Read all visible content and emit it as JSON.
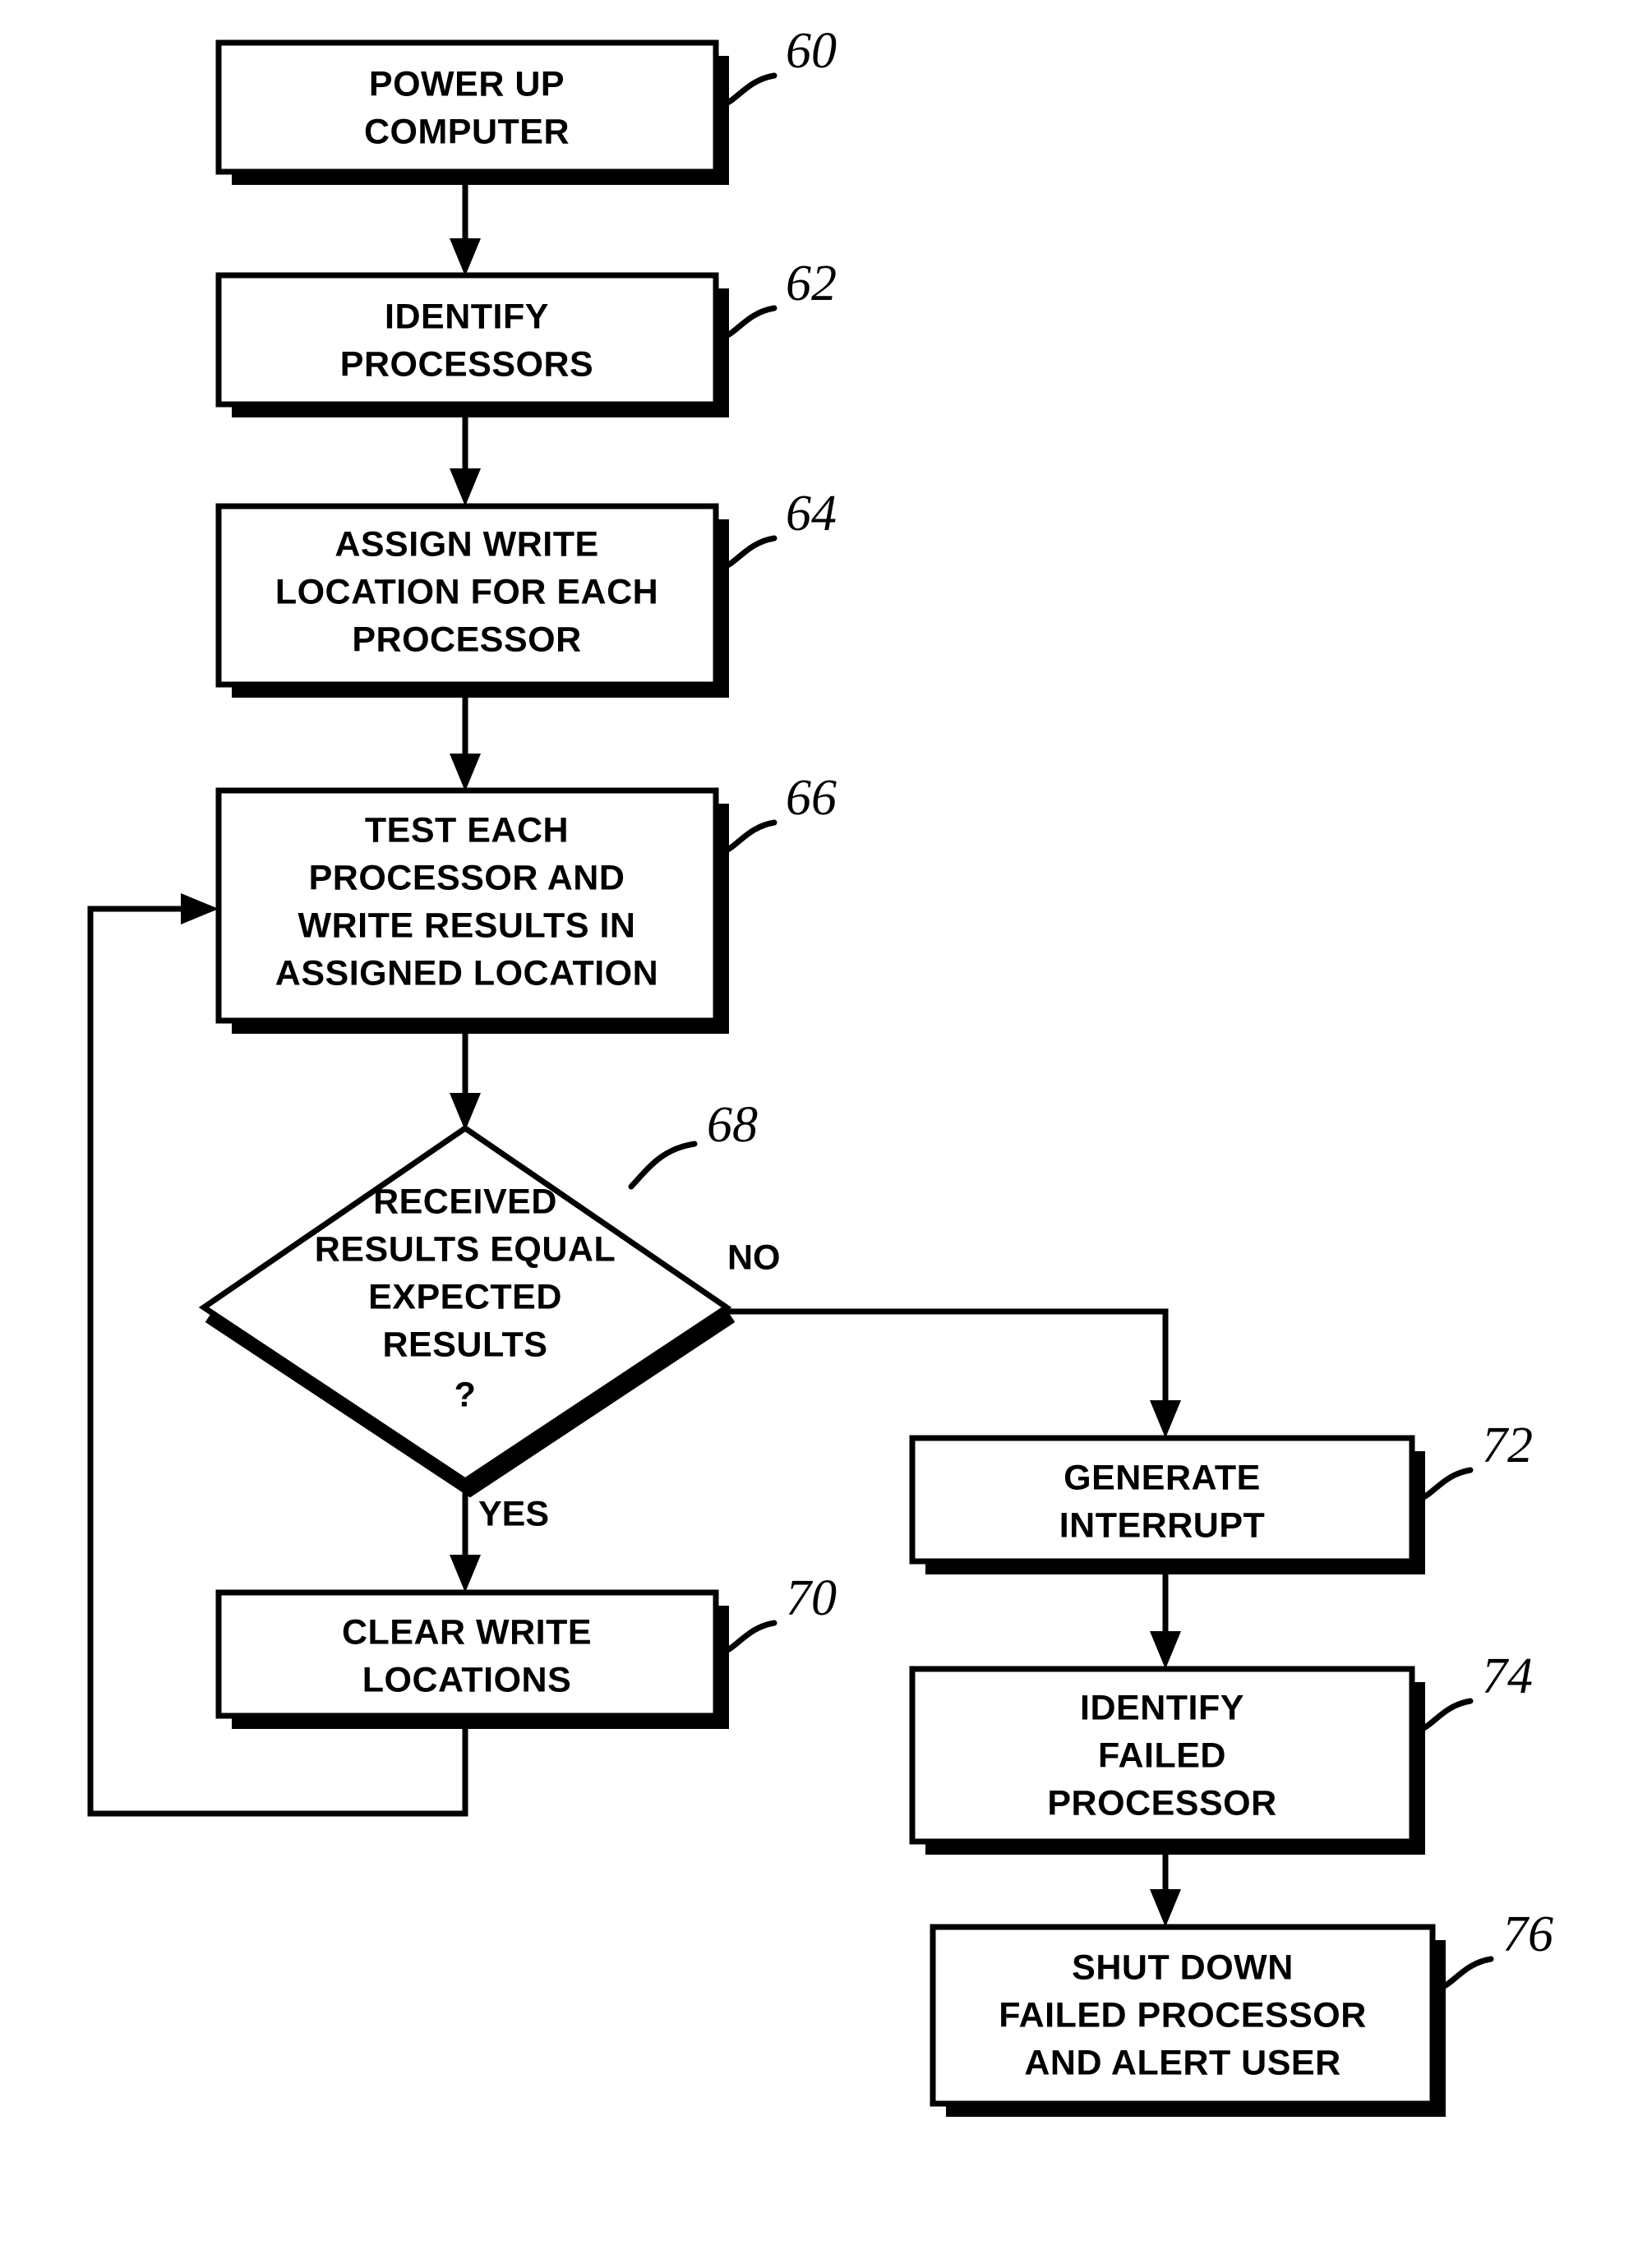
{
  "diagram": {
    "title": "Processor self-test power-up flowchart",
    "background_color": "#ffffff",
    "line_color": "#000000",
    "nodes": [
      {
        "id": "n60",
        "ref": "60",
        "shape": "process",
        "lines": [
          "POWER UP",
          "COMPUTER"
        ],
        "line1": "POWER UP",
        "line2": "COMPUTER",
        "line3": "",
        "line4": ""
      },
      {
        "id": "n62",
        "ref": "62",
        "shape": "process",
        "lines": [
          "IDENTIFY",
          "PROCESSORS"
        ],
        "line1": "IDENTIFY",
        "line2": "PROCESSORS",
        "line3": "",
        "line4": ""
      },
      {
        "id": "n64",
        "ref": "64",
        "shape": "process",
        "lines": [
          "ASSIGN WRITE",
          "LOCATION FOR EACH",
          "PROCESSOR"
        ],
        "line1": "ASSIGN WRITE",
        "line2": "LOCATION FOR EACH",
        "line3": "PROCESSOR",
        "line4": ""
      },
      {
        "id": "n66",
        "ref": "66",
        "shape": "process",
        "lines": [
          "TEST EACH",
          "PROCESSOR AND",
          "WRITE RESULTS IN",
          "ASSIGNED LOCATION"
        ],
        "line1": "TEST EACH",
        "line2": "PROCESSOR AND",
        "line3": "WRITE RESULTS IN",
        "line4": "ASSIGNED LOCATION"
      },
      {
        "id": "n68",
        "ref": "68",
        "shape": "decision",
        "lines": [
          "RECEIVED",
          "RESULTS EQUAL",
          "EXPECTED",
          "RESULTS",
          "?"
        ],
        "line1": "RECEIVED",
        "line2": "RESULTS EQUAL",
        "line3": "EXPECTED",
        "line4": "RESULTS",
        "line5": "?"
      },
      {
        "id": "n70",
        "ref": "70",
        "shape": "process",
        "lines": [
          "CLEAR WRITE",
          "LOCATIONS"
        ],
        "line1": "CLEAR WRITE",
        "line2": "LOCATIONS",
        "line3": "",
        "line4": ""
      },
      {
        "id": "n72",
        "ref": "72",
        "shape": "process",
        "lines": [
          "GENERATE",
          "INTERRUPT"
        ],
        "line1": "GENERATE",
        "line2": "INTERRUPT",
        "line3": "",
        "line4": ""
      },
      {
        "id": "n74",
        "ref": "74",
        "shape": "process",
        "lines": [
          "IDENTIFY",
          "FAILED",
          "PROCESSOR"
        ],
        "line1": "IDENTIFY",
        "line2": "FAILED",
        "line3": "PROCESSOR",
        "line4": ""
      },
      {
        "id": "n76",
        "ref": "76",
        "shape": "process",
        "lines": [
          "SHUT DOWN",
          "FAILED PROCESSOR",
          "AND ALERT USER"
        ],
        "line1": "SHUT DOWN",
        "line2": "FAILED PROCESSOR",
        "line3": "AND ALERT USER",
        "line4": ""
      }
    ],
    "edges": [
      {
        "id": "e60-62",
        "from": "n60",
        "to": "n62",
        "label": ""
      },
      {
        "id": "e62-64",
        "from": "n62",
        "to": "n64",
        "label": ""
      },
      {
        "id": "e64-66",
        "from": "n64",
        "to": "n66",
        "label": ""
      },
      {
        "id": "e66-68",
        "from": "n66",
        "to": "n68",
        "label": ""
      },
      {
        "id": "e68-70",
        "from": "n68",
        "to": "n70",
        "label": "YES"
      },
      {
        "id": "e68-72",
        "from": "n68",
        "to": "n72",
        "label": "NO"
      },
      {
        "id": "e70-66",
        "from": "n70",
        "to": "n66",
        "label": ""
      },
      {
        "id": "e72-74",
        "from": "n72",
        "to": "n74",
        "label": ""
      },
      {
        "id": "e74-76",
        "from": "n74",
        "to": "n76",
        "label": ""
      }
    ],
    "labels": {
      "yes": "YES",
      "no": "NO"
    },
    "ref_numbers": {
      "r60": "60",
      "r62": "62",
      "r64": "64",
      "r66": "66",
      "r68": "68",
      "r70": "70",
      "r72": "72",
      "r74": "74",
      "r76": "76"
    }
  }
}
